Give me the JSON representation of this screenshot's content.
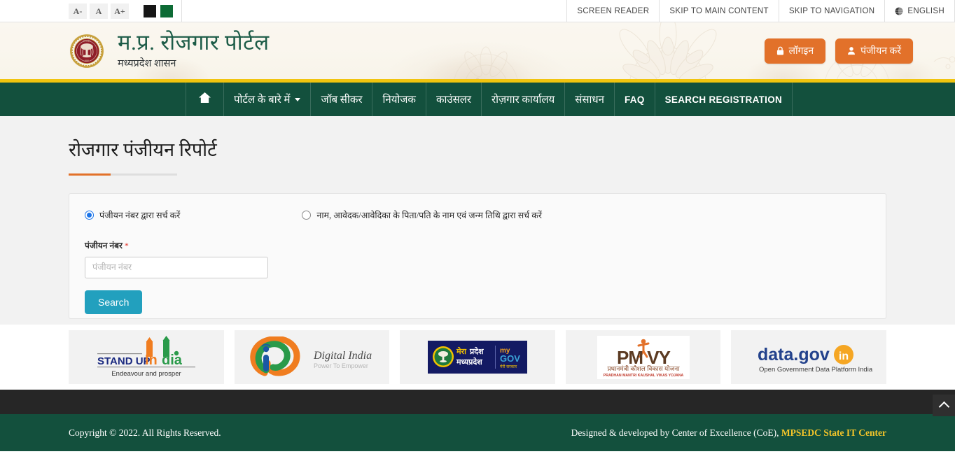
{
  "accessibility": {
    "font_decrease": "A-",
    "font_normal": "A",
    "font_increase": "A+",
    "contrast_black": "",
    "contrast_green": ""
  },
  "topbar": {
    "items": [
      {
        "label": "SCREEN READER",
        "icon": ""
      },
      {
        "label": "SKIP TO MAIN CONTENT",
        "icon": ""
      },
      {
        "label": "SKIP TO NAVIGATION",
        "icon": ""
      },
      {
        "label": "ENGLISH",
        "icon": "globe-icon"
      }
    ]
  },
  "header": {
    "emblem_alt": "madhya-pradesh-state-emblem",
    "title": "म.प्र. रोजगार पोर्टल",
    "subtitle": "मध्यप्रदेश शासन",
    "login_label": "लॉगइन",
    "register_label": "पंजीयन करें"
  },
  "nav": {
    "home_icon": "home-icon",
    "items": [
      {
        "label": "पोर्टल के बारे में",
        "has_dropdown": true,
        "latin": false
      },
      {
        "label": "जॉब सीकर",
        "has_dropdown": false,
        "latin": false
      },
      {
        "label": "नियोजक",
        "has_dropdown": false,
        "latin": false
      },
      {
        "label": "काउंसलर",
        "has_dropdown": false,
        "latin": false
      },
      {
        "label": "रोज़गार कार्यालय",
        "has_dropdown": false,
        "latin": false
      },
      {
        "label": "संसाधन",
        "has_dropdown": false,
        "latin": false
      },
      {
        "label": "FAQ",
        "has_dropdown": false,
        "latin": true
      },
      {
        "label": "SEARCH REGISTRATION",
        "has_dropdown": false,
        "latin": true
      }
    ]
  },
  "main": {
    "page_title": "रोजगार पंजीयन रिपोर्ट",
    "search_mode": {
      "option1_label": "पंजीयन नंबर द्वारा सर्च करें",
      "option1_selected": true,
      "option2_label": "नाम, आवेदक/आवेदिका के पिता/पति के नाम एवं जन्म तिथि द्वारा सर्च करें",
      "option2_selected": false
    },
    "form": {
      "registration_number_label": "पंजीयन नंबर",
      "required_mark": "*",
      "registration_number_value": "",
      "registration_number_placeholder": "पंजीयन नंबर",
      "search_button": "Search"
    }
  },
  "logos": [
    {
      "name": "stand-up-india",
      "title": "STAND UP India",
      "tagline": "Endeavour and prosper"
    },
    {
      "name": "digital-india",
      "title": "Digital India",
      "tagline": "Power To Empower"
    },
    {
      "name": "mygov-madhya-pradesh",
      "title": "मेरा प्रदेश मध्यप्रदेश",
      "tagline": "my GOV"
    },
    {
      "name": "pmkvy",
      "title": "PMKVY",
      "tagline": "प्रधानमंत्री कौशल विकास योजना"
    },
    {
      "name": "data-gov-in",
      "title": "data.gov.in",
      "tagline": "Open Government Data Platform India"
    }
  ],
  "footer": {
    "copyright": "Copyright © 2022. All Rights Reserved.",
    "credit_prefix": "Designed & developed by Center of Excellence (CoE),",
    "credit_link": "MPSEDC State IT Center",
    "to_top_icon": "chevron-up-icon"
  },
  "colors": {
    "brand_green": "#13503d",
    "accent_orange": "#e2712a",
    "accent_yellow": "#f1c40f",
    "teal_button": "#22a0be",
    "header_cream": "#faf6ee",
    "link_yellow": "#f4c52a"
  }
}
